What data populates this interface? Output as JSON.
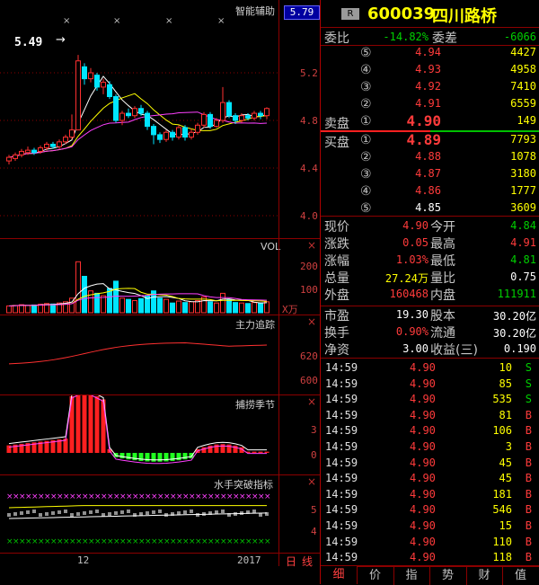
{
  "chart_panel": {
    "main_title": "智能辅助",
    "current_marker": "5.79",
    "price_label": "5.49",
    "arrow": "→",
    "axis_main": [
      "5.2",
      "4.8",
      "4.4",
      "4.0"
    ],
    "vol_title": "VOL",
    "axis_vol": [
      "200",
      "100"
    ],
    "vol_unit": "X万",
    "zl_title": "主力追踪",
    "axis_zl": [
      "620",
      "600"
    ],
    "jj_title": "捕捞季节",
    "axis_jj": [
      "3",
      "0"
    ],
    "sp_title": "水手突破指标",
    "axis_sp": [
      "5",
      "4"
    ],
    "x_labels": [
      "12",
      "2017"
    ],
    "period_label": "日线",
    "close_glyph": "×"
  },
  "quote": {
    "badge": "R",
    "code": "600039",
    "name": "四川路桥",
    "weibi_label": "委比",
    "weibi_value": "-14.82%",
    "weicha_label": "委差",
    "weicha_value": "-6066",
    "sell_label": "卖盘",
    "buy_label": "买盘",
    "asks": [
      {
        "level": "⑤",
        "price": "4.94",
        "vol": "4427"
      },
      {
        "level": "④",
        "price": "4.93",
        "vol": "4958"
      },
      {
        "level": "③",
        "price": "4.92",
        "vol": "7410"
      },
      {
        "level": "②",
        "price": "4.91",
        "vol": "6559"
      },
      {
        "level": "①",
        "price": "4.90",
        "vol": "149"
      }
    ],
    "bids": [
      {
        "level": "①",
        "price": "4.89",
        "vol": "7793"
      },
      {
        "level": "②",
        "price": "4.88",
        "vol": "1078"
      },
      {
        "level": "③",
        "price": "4.87",
        "vol": "3180"
      },
      {
        "level": "④",
        "price": "4.86",
        "vol": "1777"
      },
      {
        "level": "⑤",
        "price": "4.85",
        "vol": "3609"
      }
    ],
    "stats": [
      {
        "l1": "现价",
        "v1": "4.90",
        "l2": "今开",
        "v2": "4.84"
      },
      {
        "l1": "涨跌",
        "v1": "0.05",
        "l2": "最高",
        "v2": "4.91"
      },
      {
        "l1": "涨幅",
        "v1": "1.03%",
        "l2": "最低",
        "v2": "4.81"
      },
      {
        "l1": "总量",
        "v1": "27.24万",
        "l2": "量比",
        "v2": "0.75"
      },
      {
        "l1": "外盘",
        "v1": "160468",
        "l2": "内盘",
        "v2": "111911"
      }
    ],
    "fund": [
      {
        "l1": "市盈",
        "v1": "19.30",
        "l2": "股本",
        "v2": "30.20亿"
      },
      {
        "l1": "换手",
        "v1": "0.90%",
        "l2": "流通",
        "v2": "30.20亿"
      },
      {
        "l1": "净资",
        "v1": "3.00",
        "l2": "收益(三)",
        "v2": "0.190"
      }
    ]
  },
  "ticks": [
    {
      "time": "14:59",
      "price": "4.90",
      "vol": "10",
      "side": "S"
    },
    {
      "time": "14:59",
      "price": "4.90",
      "vol": "85",
      "side": "S"
    },
    {
      "time": "14:59",
      "price": "4.90",
      "vol": "535",
      "side": "S"
    },
    {
      "time": "14:59",
      "price": "4.90",
      "vol": "81",
      "side": "B"
    },
    {
      "time": "14:59",
      "price": "4.90",
      "vol": "106",
      "side": "B"
    },
    {
      "time": "14:59",
      "price": "4.90",
      "vol": "3",
      "side": "B"
    },
    {
      "time": "14:59",
      "price": "4.90",
      "vol": "45",
      "side": "B"
    },
    {
      "time": "14:59",
      "price": "4.90",
      "vol": "45",
      "side": "B"
    },
    {
      "time": "14:59",
      "price": "4.90",
      "vol": "181",
      "side": "B"
    },
    {
      "time": "14:59",
      "price": "4.90",
      "vol": "546",
      "side": "B"
    },
    {
      "time": "14:59",
      "price": "4.90",
      "vol": "15",
      "side": "B"
    },
    {
      "time": "14:59",
      "price": "4.90",
      "vol": "110",
      "side": "B"
    },
    {
      "time": "14:59",
      "price": "4.90",
      "vol": "118",
      "side": "B"
    }
  ],
  "tabs": [
    "细",
    "价",
    "指",
    "势",
    "财",
    "值"
  ],
  "candles": [
    {
      "o": 4.46,
      "c": 4.49,
      "h": 4.51,
      "l": 4.43
    },
    {
      "o": 4.48,
      "c": 4.51,
      "h": 4.53,
      "l": 4.46
    },
    {
      "o": 4.51,
      "c": 4.54,
      "h": 4.56,
      "l": 4.49
    },
    {
      "o": 4.53,
      "c": 4.55,
      "h": 4.58,
      "l": 4.51
    },
    {
      "o": 4.55,
      "c": 4.53,
      "h": 4.57,
      "l": 4.51
    },
    {
      "o": 4.54,
      "c": 4.57,
      "h": 4.59,
      "l": 4.52
    },
    {
      "o": 4.57,
      "c": 4.6,
      "h": 4.62,
      "l": 4.55
    },
    {
      "o": 4.6,
      "c": 4.58,
      "h": 4.62,
      "l": 4.56
    },
    {
      "o": 4.58,
      "c": 4.62,
      "h": 4.64,
      "l": 4.56
    },
    {
      "o": 4.62,
      "c": 4.66,
      "h": 4.68,
      "l": 4.6
    },
    {
      "o": 4.66,
      "c": 4.72,
      "h": 4.85,
      "l": 4.64
    },
    {
      "o": 4.72,
      "c": 5.3,
      "h": 5.35,
      "l": 4.72
    },
    {
      "o": 5.25,
      "c": 5.15,
      "h": 5.28,
      "l": 5.1
    },
    {
      "o": 5.15,
      "c": 5.2,
      "h": 5.24,
      "l": 5.12
    },
    {
      "o": 5.18,
      "c": 5.08,
      "h": 5.2,
      "l": 5.05
    },
    {
      "o": 5.08,
      "c": 5.12,
      "h": 5.15,
      "l": 5.02
    },
    {
      "o": 5.1,
      "c": 5.0,
      "h": 5.13,
      "l": 4.98
    },
    {
      "o": 5.0,
      "c": 4.8,
      "h": 5.02,
      "l": 4.78
    },
    {
      "o": 4.8,
      "c": 4.86,
      "h": 4.88,
      "l": 4.76
    },
    {
      "o": 4.86,
      "c": 4.84,
      "h": 4.9,
      "l": 4.82
    },
    {
      "o": 4.84,
      "c": 4.9,
      "h": 4.92,
      "l": 4.82
    },
    {
      "o": 4.9,
      "c": 4.86,
      "h": 4.93,
      "l": 4.84
    },
    {
      "o": 4.86,
      "c": 4.75,
      "h": 4.88,
      "l": 4.72
    },
    {
      "o": 4.75,
      "c": 4.68,
      "h": 4.77,
      "l": 4.6
    },
    {
      "o": 4.68,
      "c": 4.64,
      "h": 4.7,
      "l": 4.61
    },
    {
      "o": 4.64,
      "c": 4.7,
      "h": 4.72,
      "l": 4.62
    },
    {
      "o": 4.7,
      "c": 4.66,
      "h": 4.72,
      "l": 4.63
    },
    {
      "o": 4.66,
      "c": 4.74,
      "h": 4.76,
      "l": 4.64
    },
    {
      "o": 4.74,
      "c": 4.66,
      "h": 4.76,
      "l": 4.63
    },
    {
      "o": 4.66,
      "c": 4.7,
      "h": 4.73,
      "l": 4.64
    },
    {
      "o": 4.7,
      "c": 4.76,
      "h": 4.78,
      "l": 4.68
    },
    {
      "o": 4.76,
      "c": 4.85,
      "h": 4.87,
      "l": 4.74
    },
    {
      "o": 4.85,
      "c": 4.75,
      "h": 4.87,
      "l": 4.73
    },
    {
      "o": 4.75,
      "c": 4.8,
      "h": 4.82,
      "l": 4.74
    },
    {
      "o": 4.8,
      "c": 4.95,
      "h": 5.08,
      "l": 4.78
    },
    {
      "o": 4.95,
      "c": 4.84,
      "h": 4.97,
      "l": 4.82
    },
    {
      "o": 4.84,
      "c": 4.8,
      "h": 4.86,
      "l": 4.77
    },
    {
      "o": 4.8,
      "c": 4.84,
      "h": 4.86,
      "l": 4.78
    },
    {
      "o": 4.84,
      "c": 4.82,
      "h": 4.86,
      "l": 4.8
    },
    {
      "o": 4.82,
      "c": 4.86,
      "h": 4.88,
      "l": 4.8
    },
    {
      "o": 4.86,
      "c": 4.84,
      "h": 4.88,
      "l": 4.81
    },
    {
      "o": 4.84,
      "c": 4.9,
      "h": 4.91,
      "l": 4.81
    }
  ],
  "volumes": [
    28,
    30,
    33,
    30,
    32,
    35,
    38,
    36,
    40,
    45,
    60,
    210,
    150,
    90,
    80,
    70,
    100,
    130,
    60,
    55,
    50,
    58,
    70,
    90,
    60,
    55,
    40,
    48,
    42,
    45,
    50,
    65,
    45,
    40,
    80,
    55,
    42,
    40,
    38,
    42,
    40,
    45
  ],
  "colors": {
    "up": "#ff3030",
    "down": "#00e5ff",
    "ma1": "#ffffff",
    "ma2": "#ffff00",
    "ma3": "#ff40ff",
    "grid": "#8b0000"
  }
}
